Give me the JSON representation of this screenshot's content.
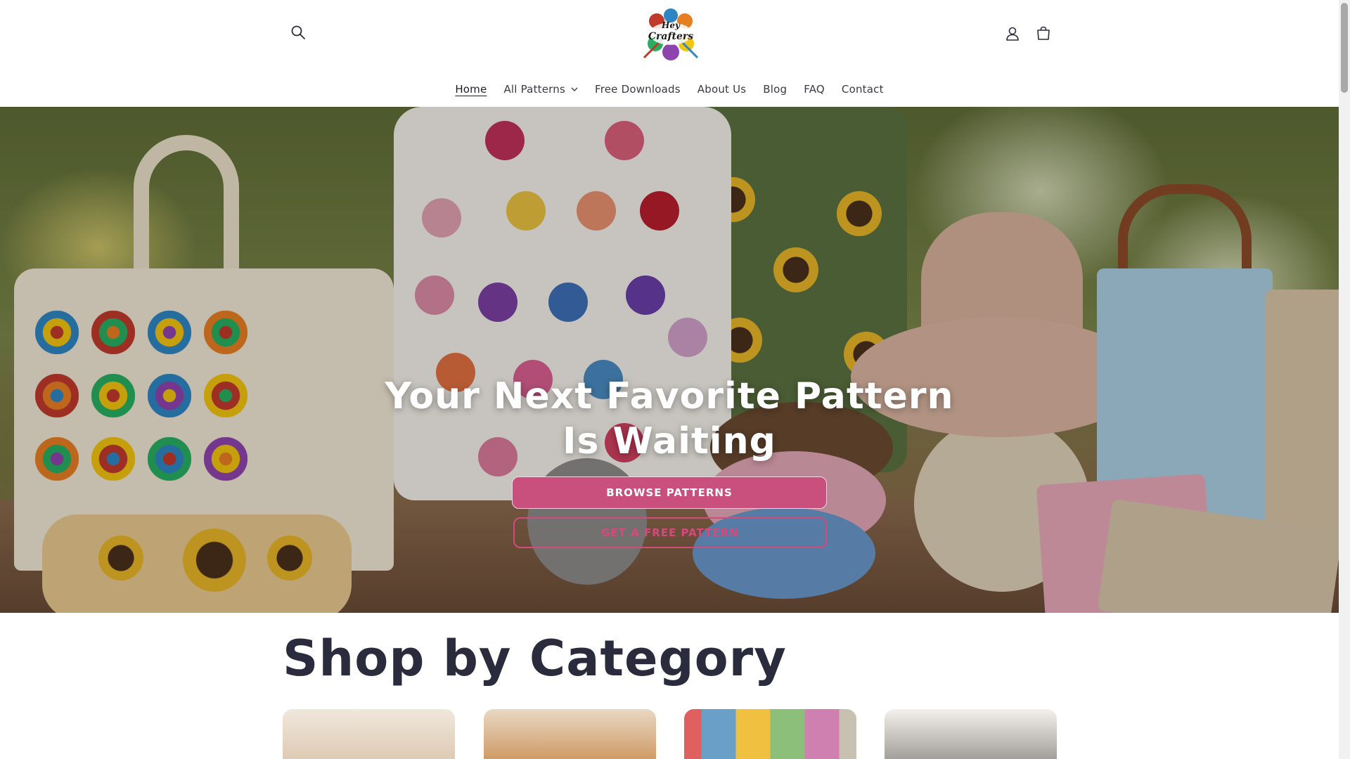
{
  "header": {
    "logo_alt": "Hey Crafters",
    "logo_text_line1": "Hey",
    "logo_text_line2": "Crafters",
    "icons": {
      "search": "search-icon",
      "account": "account-icon",
      "cart": "cart-icon"
    }
  },
  "nav": {
    "items": [
      {
        "label": "Home",
        "active": true
      },
      {
        "label": "All Patterns",
        "has_dropdown": true
      },
      {
        "label": "Free Downloads"
      },
      {
        "label": "About Us"
      },
      {
        "label": "Blog"
      },
      {
        "label": "FAQ"
      },
      {
        "label": "Contact"
      }
    ]
  },
  "hero": {
    "title": "Your Next Favorite Pattern Is Waiting",
    "primary_button": "BROWSE PATTERNS",
    "secondary_button": "GET A FREE PATTERN"
  },
  "categories": {
    "title": "Shop by Category"
  },
  "colors": {
    "accent": "#c94f7c",
    "accent_outline": "#d54a7c",
    "heading": "#2a2b3c"
  }
}
